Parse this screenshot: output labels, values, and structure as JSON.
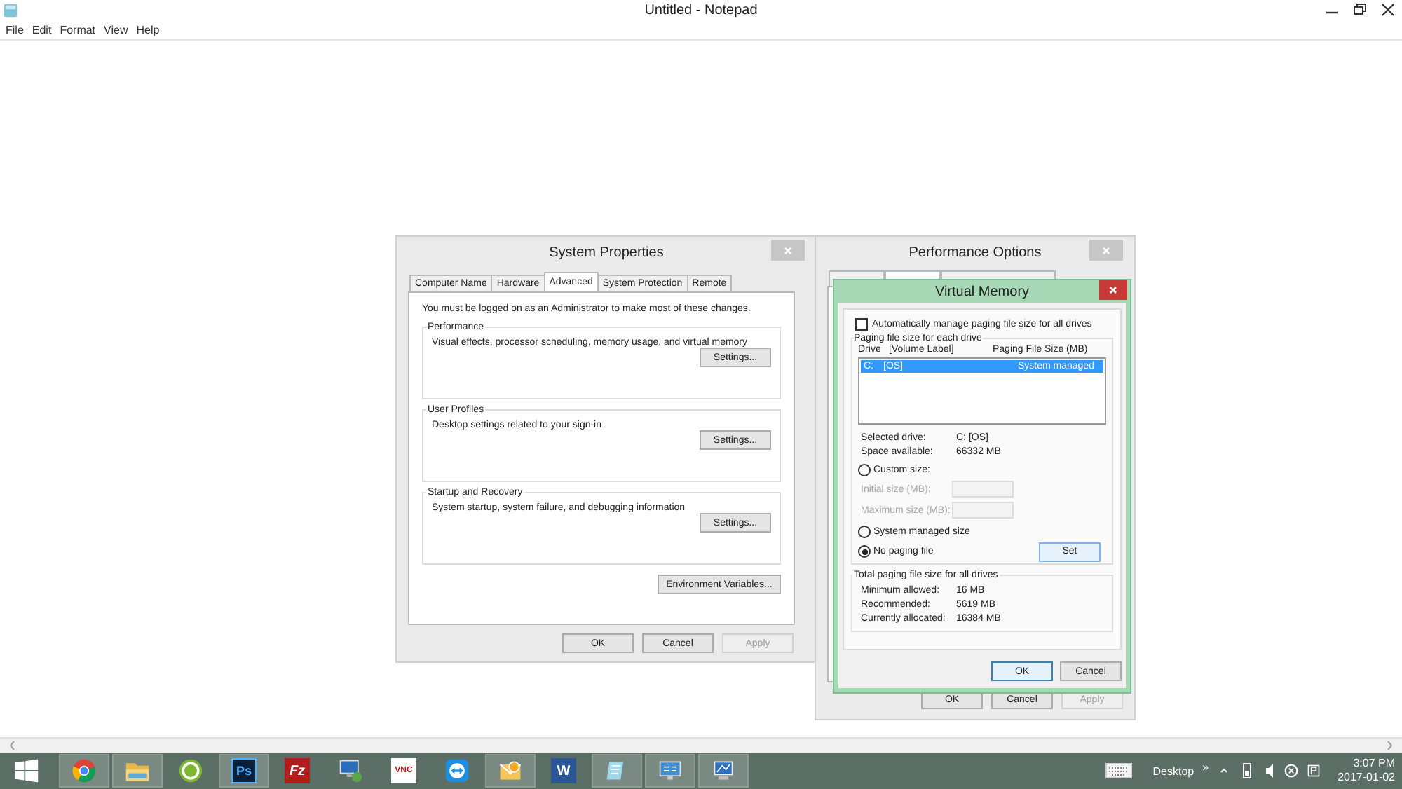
{
  "notepad": {
    "title": "Untitled - Notepad",
    "menu": [
      "File",
      "Edit",
      "Format",
      "View",
      "Help"
    ]
  },
  "system_properties": {
    "title": "System Properties",
    "tabs": [
      {
        "label": "Computer Name",
        "selected": false
      },
      {
        "label": "Hardware",
        "selected": false
      },
      {
        "label": "Advanced",
        "selected": true
      },
      {
        "label": "System Protection",
        "selected": false
      },
      {
        "label": "Remote",
        "selected": false
      }
    ],
    "note": "You must be logged on as an Administrator to make most of these changes.",
    "groups": [
      {
        "title": "Performance",
        "description": "Visual effects, processor scheduling, memory usage, and virtual memory",
        "button": "Settings..."
      },
      {
        "title": "User Profiles",
        "description": "Desktop settings related to your sign-in",
        "button": "Settings..."
      },
      {
        "title": "Startup and Recovery",
        "description": "System startup, system failure, and debugging information",
        "button": "Settings..."
      }
    ],
    "env_button": "Environment Variables...",
    "buttons": [
      {
        "label": "OK",
        "disabled": false
      },
      {
        "label": "Cancel",
        "disabled": false
      },
      {
        "label": "Apply",
        "disabled": true
      }
    ]
  },
  "performance_options": {
    "title": "Performance Options",
    "tabs": [
      {
        "selected": false
      },
      {
        "selected": true
      },
      {
        "selected": false
      }
    ],
    "buttons": [
      {
        "label": "OK",
        "disabled": false
      },
      {
        "label": "Cancel",
        "disabled": false
      },
      {
        "label": "Apply",
        "disabled": true
      }
    ]
  },
  "virtual_memory": {
    "title": "Virtual Memory",
    "auto_manage": {
      "label": "Automatically manage paging file size for all drives",
      "checked": false
    },
    "drives_group": "Paging file size for each drive",
    "columns": [
      "Drive",
      "[Volume Label]",
      "Paging File Size (MB)"
    ],
    "rows": [
      {
        "drive": "C:",
        "label": "[OS]",
        "size": "System managed",
        "selected": true
      }
    ],
    "info": [
      {
        "label": "Selected drive:",
        "value": "C:  [OS]"
      },
      {
        "label": "Space available:",
        "value": "66332 MB"
      }
    ],
    "options": [
      {
        "label": "Custom size:",
        "selected": false
      },
      {
        "label": "System managed size",
        "selected": false
      },
      {
        "label": "No paging file",
        "selected": true
      }
    ],
    "size_fields": [
      {
        "label": "Initial size (MB):",
        "disabled": true
      },
      {
        "label": "Maximum size (MB):",
        "disabled": true
      }
    ],
    "set_button": "Set",
    "totals_title": "Total paging file size for all drives",
    "totals": [
      {
        "label": "Minimum allowed:",
        "value": "16 MB"
      },
      {
        "label": "Recommended:",
        "value": "5619 MB"
      },
      {
        "label": "Currently allocated:",
        "value": "16384 MB"
      }
    ],
    "buttons": [
      {
        "label": "OK",
        "default": true
      },
      {
        "label": "Cancel",
        "default": false
      }
    ]
  },
  "taskbar": {
    "apps": [
      {
        "kind": "browser",
        "running": true
      },
      {
        "kind": "folder",
        "running": true
      },
      {
        "kind": "dreamweaver",
        "running": false
      },
      {
        "kind": "photoshop",
        "running": true,
        "text": "Ps"
      },
      {
        "kind": "filezilla",
        "running": false,
        "text": "Fz"
      },
      {
        "kind": "remote",
        "running": false
      },
      {
        "kind": "vnc",
        "running": false,
        "text": "VNC"
      },
      {
        "kind": "teamviewer",
        "running": false
      },
      {
        "kind": "outlook",
        "running": true
      },
      {
        "kind": "word",
        "running": false,
        "text": "W"
      },
      {
        "kind": "notepad",
        "running": true
      },
      {
        "kind": "panel",
        "running": true
      },
      {
        "kind": "system",
        "running": true
      }
    ],
    "toolbar_label": "Desktop",
    "overflow": "»",
    "time": "3:07 PM",
    "date": "2017-01-02"
  }
}
